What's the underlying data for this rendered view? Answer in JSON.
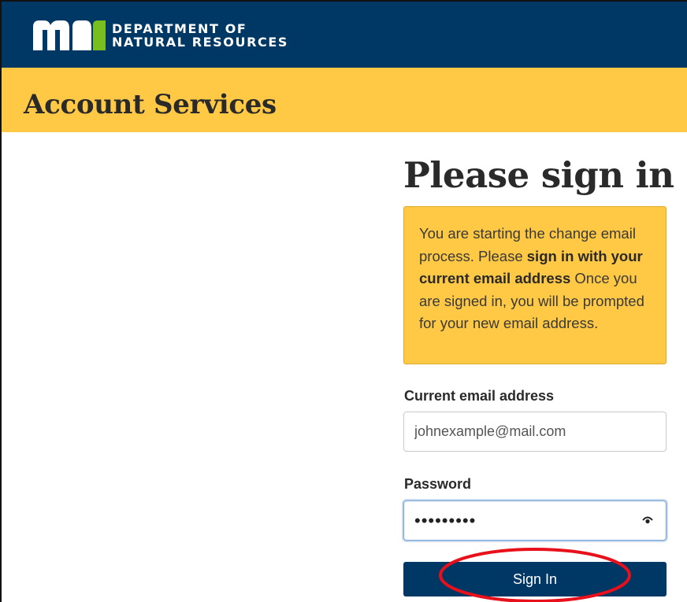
{
  "header": {
    "logo_alt": "mn",
    "org_line1": "DEPARTMENT OF",
    "org_line2": "NATURAL RESOURCES",
    "brand_color": "#003865"
  },
  "band": {
    "title": "Account Services",
    "color": "#ffc845"
  },
  "main": {
    "heading": "Please sign in",
    "notice": {
      "text_before": "You are starting the change email process. Please ",
      "text_bold": "sign in with your current email address",
      "text_after": " Once you are signed in, you will be prompted for your new email address."
    },
    "email": {
      "label": "Current email address",
      "value": "johnexample@mail.com"
    },
    "password": {
      "label": "Password",
      "value": "password1",
      "toggle_icon": "eye-icon"
    },
    "submit_label": "Sign In"
  },
  "annotation": {
    "shape": "ellipse",
    "color": "#e8101a"
  }
}
